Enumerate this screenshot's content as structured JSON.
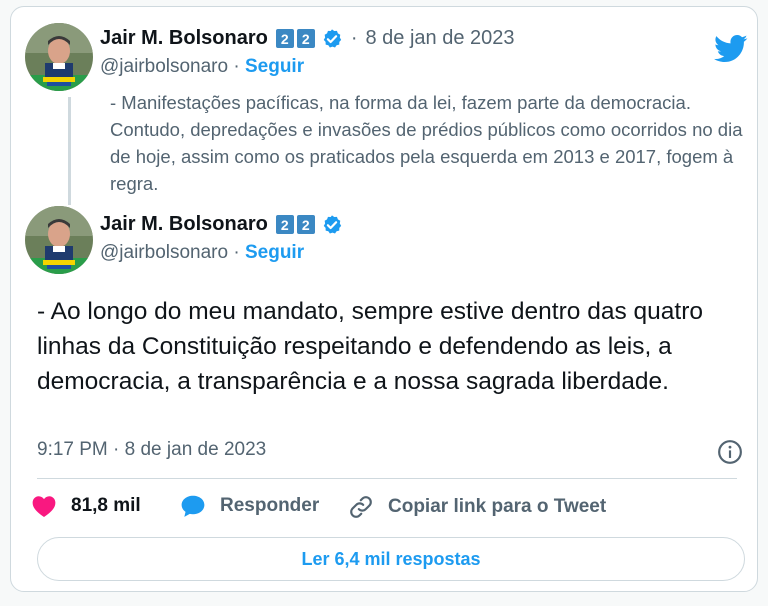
{
  "colors": {
    "accent": "#1d9bf0",
    "heart": "#f91880",
    "text_primary": "#0f1419",
    "text_secondary": "#536471",
    "border": "#cfd9de"
  },
  "icons": {
    "logo": "twitter-bird-icon",
    "verified": "verified-badge-icon",
    "info": "info-icon",
    "like": "heart-icon",
    "reply": "speech-bubble-icon",
    "copy_link": "link-icon"
  },
  "quoted_tweet": {
    "author_name": "Jair M. Bolsonaro",
    "badge_1": "2",
    "badge_2": "2",
    "separator": "·",
    "date": "8 de jan de 2023",
    "handle": "@jairbolsonaro",
    "follow_separator": "·",
    "follow_label": "Seguir",
    "text": "- Manifestações pacíficas, na forma da lei, fazem parte da democracia. Contudo, depredações e invasões de prédios públicos como ocorridos no dia de hoje, assim como os praticados pela esquerda em 2013 e 2017, fogem à regra."
  },
  "main_tweet": {
    "author_name": "Jair M. Bolsonaro",
    "badge_1": "2",
    "badge_2": "2",
    "handle": "@jairbolsonaro",
    "follow_separator": "·",
    "follow_label": "Seguir",
    "text": "- Ao longo do meu mandato, sempre estive dentro das quatro linhas da Constituição respeitando e defendendo as leis, a democracia, a transparência e a nossa sagrada liberdade.",
    "timestamp": "9:17 PM · 8 de jan de 2023"
  },
  "actions": {
    "like_count": "81,8 mil",
    "reply_label": "Responder",
    "copy_link_label": "Copiar link para o Tweet"
  },
  "read_replies_label": "Ler 6,4 mil respostas"
}
